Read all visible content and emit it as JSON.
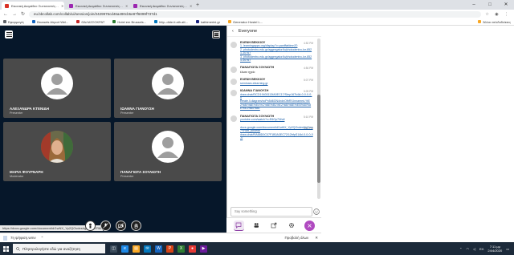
{
  "browser": {
    "tabs": [
      {
        "label": "Εικονική Διαμάθια: Συντονιστές…",
        "color": "#d93025",
        "active": true
      },
      {
        "label": "Εικονική Διαμάθια: Συντονιστές…",
        "color": "#9c27b0",
        "active": false
      },
      {
        "label": "Εικονική Διαμάθια: Συντονιστές…",
        "color": "#9c27b0",
        "active": false
      }
    ],
    "new_tab": "+",
    "window_buttons": [
      "–",
      "□",
      "✕"
    ],
    "url": "eu.bbcollab.com/collab/ui/session/join/2429976cd46a490cb5e87f6099f737d1",
    "bookmarks": [
      {
        "label": "Εφαρμογές",
        "color": "#5f6368"
      },
      {
        "label": "Brussels Airport Wel...",
        "color": "#1565c0"
      },
      {
        "label": "ΘΑΛΑΣΣΟΚΡΑΤ",
        "color": "#c62828"
      },
      {
        "label": "Hotel em Brussels...",
        "color": "#2e7d32"
      },
      {
        "label": "http--dide-ti.ath.att...",
        "color": "#0277bd"
      },
      {
        "label": "kathimerini.gr",
        "color": "#1a237e"
      },
      {
        "label": "Generator Hostel L...",
        "color": "#f9a825"
      }
    ],
    "bookmarks_right": "Άλλοι σελιδοδείκτες"
  },
  "tiles": [
    {
      "name": "ΑΛΕΞΑΝΔΡΑ ΚΤΕΝΙΔΗ",
      "role": "Presenter",
      "photo": false
    },
    {
      "name": "ΙΩΑΝΝΑ ΓΙΑΝΟΥΣΗ",
      "role": "Presenter",
      "photo": false
    },
    {
      "name": "ΜΑΡΙΑ ΦΟΥΡΝΑΡΗ",
      "role": "Moderator",
      "photo": true
    },
    {
      "name": "ΠΑΝΑΓΙΩΤΑ ΣΟΥΛΙΩΤΗ",
      "role": "Presenter",
      "photo": false
    }
  ],
  "status_url": "https://docs.google.com/document/d/1wNX_Yp2QOvdeshgZmn7YR8ft_pAvedit",
  "chat": {
    "title": "Everyone",
    "messages": [
      {
        "who": "ΕΛΕΝΗ ΒΕΚΚΙΟΥ",
        "time": "4:52 PM",
        "lines": [],
        "links": [
          "1. learningapps.org/display?v=pwdftafdmn20",
          "2. photodentro.edu.gr/aggregator/lo/photodentro-lor-8521-10767",
          "3. photodentro.edu.gr/aggregator/lo/photodentro-lor-8521-10767"
        ]
      },
      {
        "who": "ΠΑΝΑΓΙΩΤΑ ΣΟΥΛΙΩΤΗ",
        "time": "4:54 PM",
        "lines": [
          "έλυσε ηχείο"
        ],
        "links": []
      },
      {
        "who": "ΕΛΕΝΗ ΒΕΚΚΙΟΥ",
        "time": "5:07 PM",
        "lines": [],
        "links": [
          "seminars.elearning.gr"
        ]
      },
      {
        "who": "ΙΩΑΝΝΑ ΓΙΑΝΟΥΣΗ",
        "time": "5:09 PM",
        "lines": [],
        "links": [
          "draw.chat/f3CD19400113fA0EC17/Step167k4kl-0-0-0-0-0",
          "create.li.diagram/xoPn5d6GN4ndnOfbR/Unnamed-%E2%80%8E%E0%C%8E%B1%E2%80%8E%EB%80%8E%E1%80%8E"
        ]
      },
      {
        "who": "ΠΑΝΑΓΙΩΤΑ ΣΟΥΛΙΩΤΗ",
        "time": "5:10 PM",
        "lines": [],
        "links": [
          "youtube.com/watch?v=E6Gp7Nhdl"
        ]
      },
      {
        "who": "",
        "time": "5:11 PM",
        "lines": [],
        "links": [
          "docs.google.com/document/d/1wNX_Yp2QOvdesNgZmn7YR8ft_pAvedit",
          "draw.chat/f9A88D0C07F1B0A3EC72/12bfpS14kl-0-0-0-0-0"
        ]
      }
    ],
    "input_placeholder": "Say something"
  },
  "download": {
    "file": "7η ψήφιση.wmv",
    "show_all": "Προβολή όλων",
    "close": "✕"
  },
  "taskbar": {
    "search_placeholder": "Πληκτρολογήστε εδώ για αναζήτηση",
    "apps": [
      {
        "glyph": "◫",
        "color": "#3a4a5a"
      },
      {
        "glyph": "e",
        "color": "#1e88e5"
      },
      {
        "glyph": "▤",
        "color": "#f9a825"
      },
      {
        "glyph": "✉",
        "color": "#0277bd"
      },
      {
        "glyph": "W",
        "color": "#1565c0"
      },
      {
        "glyph": "P",
        "color": "#d84315"
      },
      {
        "glyph": "X",
        "color": "#2e7d32"
      },
      {
        "glyph": "●",
        "color": "#e53935"
      },
      {
        "glyph": "▶",
        "color": "#6a1b9a"
      }
    ],
    "lang": "ΕΛ",
    "time": "7:11 μμ",
    "date": "24/4/2020"
  }
}
